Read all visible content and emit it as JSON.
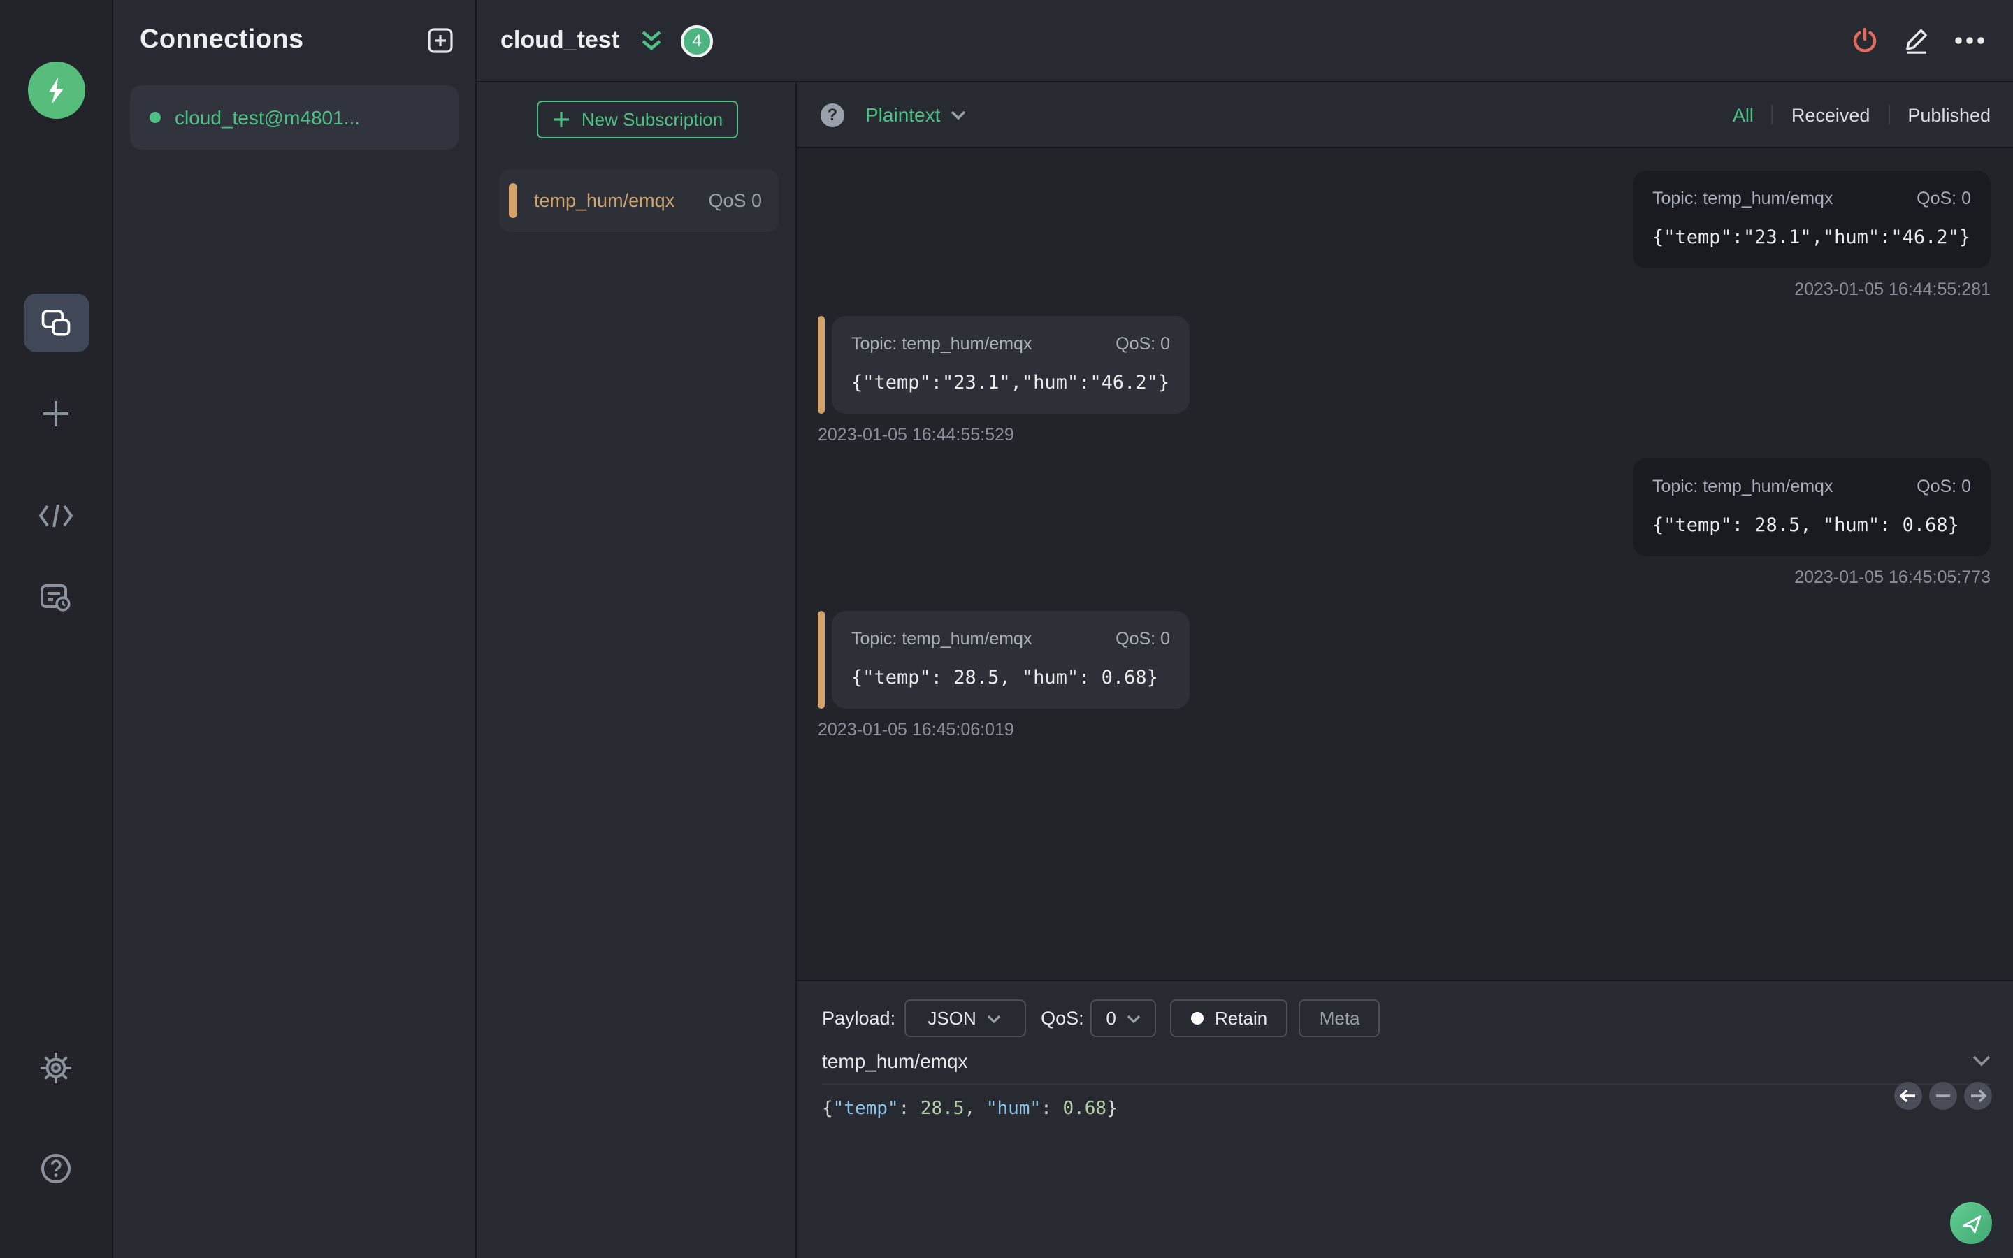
{
  "colors": {
    "accent_green": "#4ec087",
    "badge_green": "#4db380",
    "subscription_orange": "#d4a36c",
    "power_red": "#e26a5f",
    "panel_bg": "#282a31",
    "message_list_bg": "#232429",
    "published_card_bg": "#1a1b20",
    "received_card_bg": "#2e3038",
    "editor_key_blue": "#8cc3e8",
    "editor_number_green": "#b5cea8"
  },
  "rail": {
    "logo": "mqttx-logo",
    "items": [
      "connections",
      "new-connection",
      "script",
      "log"
    ],
    "bottom_items": [
      "settings",
      "help"
    ]
  },
  "connections": {
    "title": "Connections",
    "add_button": "new-connection-plus",
    "items": [
      {
        "name": "cloud_test@m4801...",
        "status": "connected"
      }
    ]
  },
  "header": {
    "title": "cloud_test",
    "badge_count": "4",
    "actions": [
      "disconnect-power",
      "edit-pencil",
      "more-ellipsis"
    ]
  },
  "subscriptions": {
    "new_button_label": "New Subscription",
    "items": [
      {
        "topic": "temp_hum/emqx",
        "qos": "QoS 0"
      }
    ]
  },
  "messages": {
    "format_selector": "Plaintext",
    "tabs": [
      {
        "label": "All",
        "active": true
      },
      {
        "label": "Received",
        "active": false
      },
      {
        "label": "Published",
        "active": false
      }
    ],
    "items": [
      {
        "direction": "published",
        "topic_line": "Topic: temp_hum/emqx",
        "qos_line": "QoS: 0",
        "payload": "{\"temp\":\"23.1\",\"hum\":\"46.2\"}",
        "time": "2023-01-05 16:44:55:281"
      },
      {
        "direction": "received",
        "topic_line": "Topic: temp_hum/emqx",
        "qos_line": "QoS: 0",
        "payload": "{\"temp\":\"23.1\",\"hum\":\"46.2\"}",
        "time": "2023-01-05 16:44:55:529"
      },
      {
        "direction": "published",
        "topic_line": "Topic: temp_hum/emqx",
        "qos_line": "QoS: 0",
        "payload": "{\"temp\": 28.5, \"hum\": 0.68}",
        "time": "2023-01-05 16:45:05:773"
      },
      {
        "direction": "received",
        "topic_line": "Topic: temp_hum/emqx",
        "qos_line": "QoS: 0",
        "payload": "{\"temp\": 28.5, \"hum\": 0.68}",
        "time": "2023-01-05 16:45:06:019"
      }
    ]
  },
  "publish": {
    "payload_label": "Payload:",
    "payload_format": "JSON",
    "qos_label": "QoS:",
    "qos_value": "0",
    "retain_label": "Retain",
    "meta_label": "Meta",
    "topic": "temp_hum/emqx",
    "editor": {
      "brace_open": "{",
      "key_temp": "\"temp\"",
      "sep1": ": ",
      "num_temp": "28.5",
      "comma": ", ",
      "key_hum": "\"hum\"",
      "sep2": ": ",
      "num_hum": "0.68",
      "brace_close": "}"
    }
  }
}
